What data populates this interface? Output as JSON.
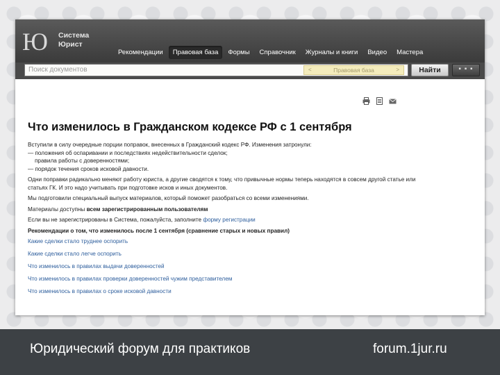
{
  "app": {
    "logo_mark": "Ю",
    "logo_line1": "Система",
    "logo_line2": "Юрист"
  },
  "nav": {
    "items": [
      "Рекомендации",
      "Правовая база",
      "Формы",
      "Справочник",
      "Журналы и книги",
      "Видео",
      "Мастера"
    ],
    "active_index": 1
  },
  "search": {
    "placeholder": "Поиск документов",
    "scope_label": "Правовая база",
    "scope_prev": "<",
    "scope_next": ">",
    "button_label": "Найти",
    "more_label": "▪ ▪ ▪"
  },
  "toolbar": {
    "icons": [
      "print-icon",
      "document-icon",
      "email-icon"
    ]
  },
  "article": {
    "title": "Что изменилось в Гражданском кодексе РФ с 1 сентября",
    "intro": "Вступили в силу очередные порции поправок, внесенных в Гражданский кодекс РФ. Изменения затронули:",
    "bullets": [
      "— положения об оспаривании и последствиях недействительности сделок;",
      "правила работы с доверенностями;",
      "— порядок течения сроков исковой давности."
    ],
    "para2": "Одни поправки радикально меняют работу юриста, а другие сводятся к тому, что привычные нормы теперь находятся в совсем другой статье или статьях ГК. И это надо учитывать при подготовке исков и иных документов.",
    "para3": "Мы подготовили специальный выпуск материалов, который поможет разобраться со всеми изменениями.",
    "access_prefix": "Материалы доступны ",
    "access_bold": "всем зарегистрированным пользователям",
    "register_text": "Если вы не зарегистрированы в Система, пожалуйста, заполните ",
    "register_link": "форму регистрации",
    "rec_heading": "Рекомендации о том, что изменилось после 1 сентября (сравнение старых и новых правил)",
    "links": [
      "Какие сделки стало труднее оспорить",
      "Какие сделки стало легче оспорить",
      "Что изменилось в правилах выдачи доверенностей",
      "Что изменилось в правилах проверки доверенностей чужим представителем",
      "Что изменилось в правилах о сроке исковой давности"
    ]
  },
  "footer": {
    "left": "Юридический форум для практиков",
    "right": "forum.1jur.ru"
  }
}
